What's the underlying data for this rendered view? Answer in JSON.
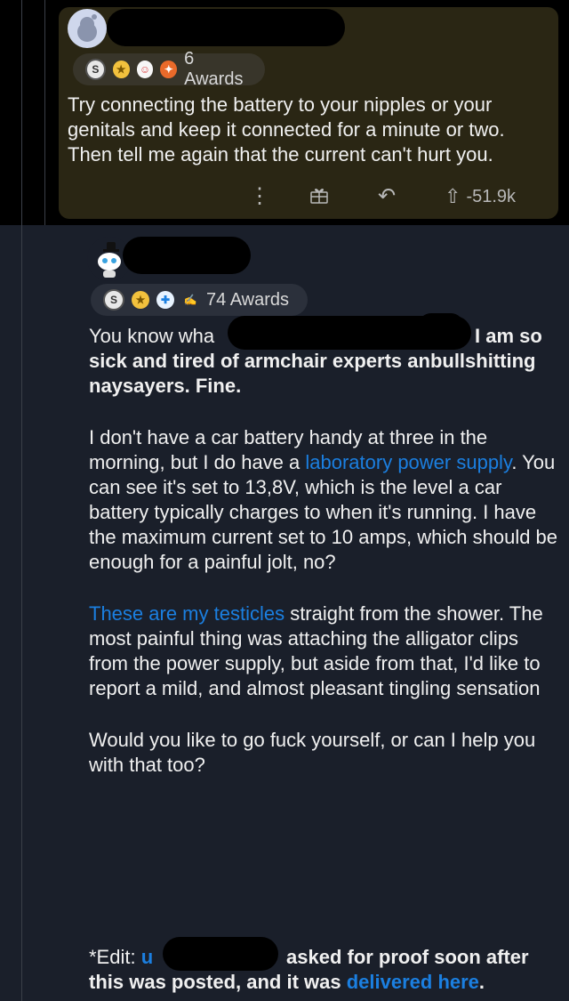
{
  "parent": {
    "awards_label": "6 Awards",
    "body": "Try connecting the battery to your nipples or your genitals and keep it connected for a minute or two. Then tell me again that the current can't hurt you.",
    "vote_count": "-51.9k"
  },
  "reply": {
    "awards_label": "74 Awards",
    "intro_start": "You know wha",
    "intro_after_redaction_line1": "I am so",
    "intro_line2_a": "sick and tired of armchair experts an",
    "intro_line2_b": "bullshitting",
    "intro_line3": "naysayers. Fine.",
    "p2_a": "I don't have a car battery handy at three in the morning, but I do have a ",
    "p2_link": "laboratory power supply",
    "p2_b": ". You can see it's set to 13,8V, which is the level a car battery typically charges to when it's running. I have the maximum current set to 10 amps, which should be enough for a painful jolt, no?",
    "p3_link": "These are my testicles",
    "p3_b": " straight from the shower. The most painful thing was attaching the alligator clips from the power supply, but aside from that, I'd like to report a mild, and almost pleasant tingling sensation",
    "p4": "Would you like to go fuck yourself, or can I help you with that too?",
    "edit_prefix": "*Edit: ",
    "edit_u": "u",
    "edit_after": "asked for proof soon after",
    "edit_line2": "this was posted, and it was ",
    "edit_link": "delivered here",
    "edit_end": "."
  },
  "colors": {
    "link": "#1b7fe0",
    "background": "#1a1f2a",
    "parent_card": "#2a2614"
  },
  "icons": [
    "avatar-snoo-icon",
    "award-silver-icon",
    "award-gold-icon",
    "more-options-icon",
    "give-award-icon",
    "reply-icon",
    "upvote-icon"
  ]
}
